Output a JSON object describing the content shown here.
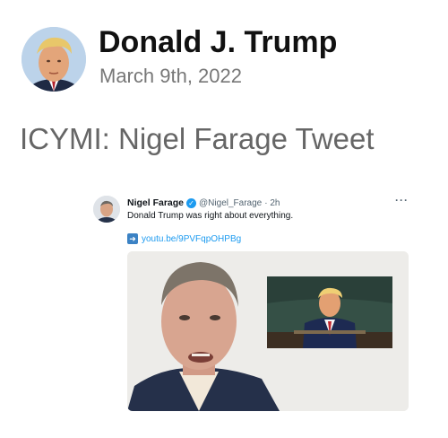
{
  "post": {
    "author_name": "Donald J. Trump",
    "date": "March 9th, 2022",
    "title": "ICYMI: Nigel Farage Tweet"
  },
  "embedded_tweet": {
    "display_name": "Nigel Farage",
    "verified_icon": "verified-badge-icon",
    "handle": "@Nigel_Farage",
    "time": "· 2h",
    "more": "···",
    "text": "Donald Trump was right about everything.",
    "link_icon": "arrow-right-icon",
    "link": "youtu.be/9PVFqpOHPBg"
  },
  "colors": {
    "link_blue": "#1d9bf0",
    "verified_blue": "#1d9bf0",
    "date_gray": "#777777",
    "title_gray": "#666666"
  }
}
